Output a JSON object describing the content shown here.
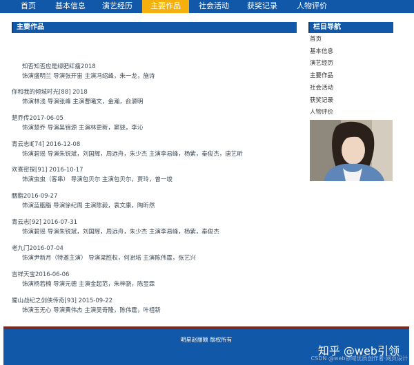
{
  "nav": {
    "items": [
      {
        "label": "首页"
      },
      {
        "label": "基本信息"
      },
      {
        "label": "演艺经历"
      },
      {
        "label": "主要作品",
        "active": true
      },
      {
        "label": "社会活动"
      },
      {
        "label": "获奖记录"
      },
      {
        "label": "人物评价"
      }
    ],
    "colors": {
      "bar": "#1258a8",
      "active": "#f5b00e"
    }
  },
  "main": {
    "title": "主要作品",
    "works": [
      {
        "title": "知否知否应是绿肥红瘦2018",
        "cast": "饰演盛明兰 导演张开宙 主演冯绍峰，朱一龙，施诗"
      },
      {
        "title": "你和我的倾城时光[88] 2018",
        "cast": "饰演林浅 导演张峰 主演曹曦文，金瀚，俞灏明"
      },
      {
        "title": "楚乔传2017-06-05",
        "cast": "饰演楚乔 导演吴锦源 主演林更新，窦骁，李沁"
      },
      {
        "title": "青云志Ⅱ[74] 2016-12-08",
        "cast": "饰演碧瑶 导演朱锐斌，刘国辉，周远舟，朱少杰 主演李易峰，杨紫，秦俊杰，唐艺昕"
      },
      {
        "title": "欢喜密探[91] 2016-10-17",
        "cast": "饰演虫虫（客串） 导演包贝尔 主演包贝尔，贾玲，曾一竣"
      },
      {
        "title": "胭脂2016-09-27",
        "cast": "饰演蓝胭脂 导演徐纪周 主演陈毅，袁文康，陶昕然"
      },
      {
        "title": "青云志[92] 2016-07-31",
        "cast": "饰演碧瑶 导演朱锐斌，刘国辉，周远舟，朱少杰 主演李易峰，杨紫，秦俊杰"
      },
      {
        "title": "老九门2016-07-04",
        "cast": "饰演尹新月（特邀主演） 导演梁胜权，何澍培 主演陈伟霆，张艺兴"
      },
      {
        "title": "吉祥天宝2016-06-06",
        "cast": "饰演杨若楠 导演元德 主演金起范，朱梓骁，陈昱霖"
      },
      {
        "title": "蜀山战纪之剑侠传奇[93] 2015-09-22",
        "cast": "饰演玉无心 导演黄伟杰 主演吴奇隆，陈伟霆，叶祖新"
      }
    ]
  },
  "sidebar": {
    "title": "栏目导航",
    "links": [
      {
        "label": "首页"
      },
      {
        "label": "基本信息"
      },
      {
        "label": "演艺经历"
      },
      {
        "label": "主要作品"
      },
      {
        "label": "社会活动"
      },
      {
        "label": "获奖记录"
      },
      {
        "label": "人物评价"
      }
    ]
  },
  "footer": {
    "copyright": "明星赵丽颖 版权所有",
    "watermark": "知乎 @web引领",
    "csdn": "CSDN @web领域优质创作者·网页设计",
    "colors": {
      "band": "#1258a8",
      "line": "#7d2a1e"
    }
  }
}
